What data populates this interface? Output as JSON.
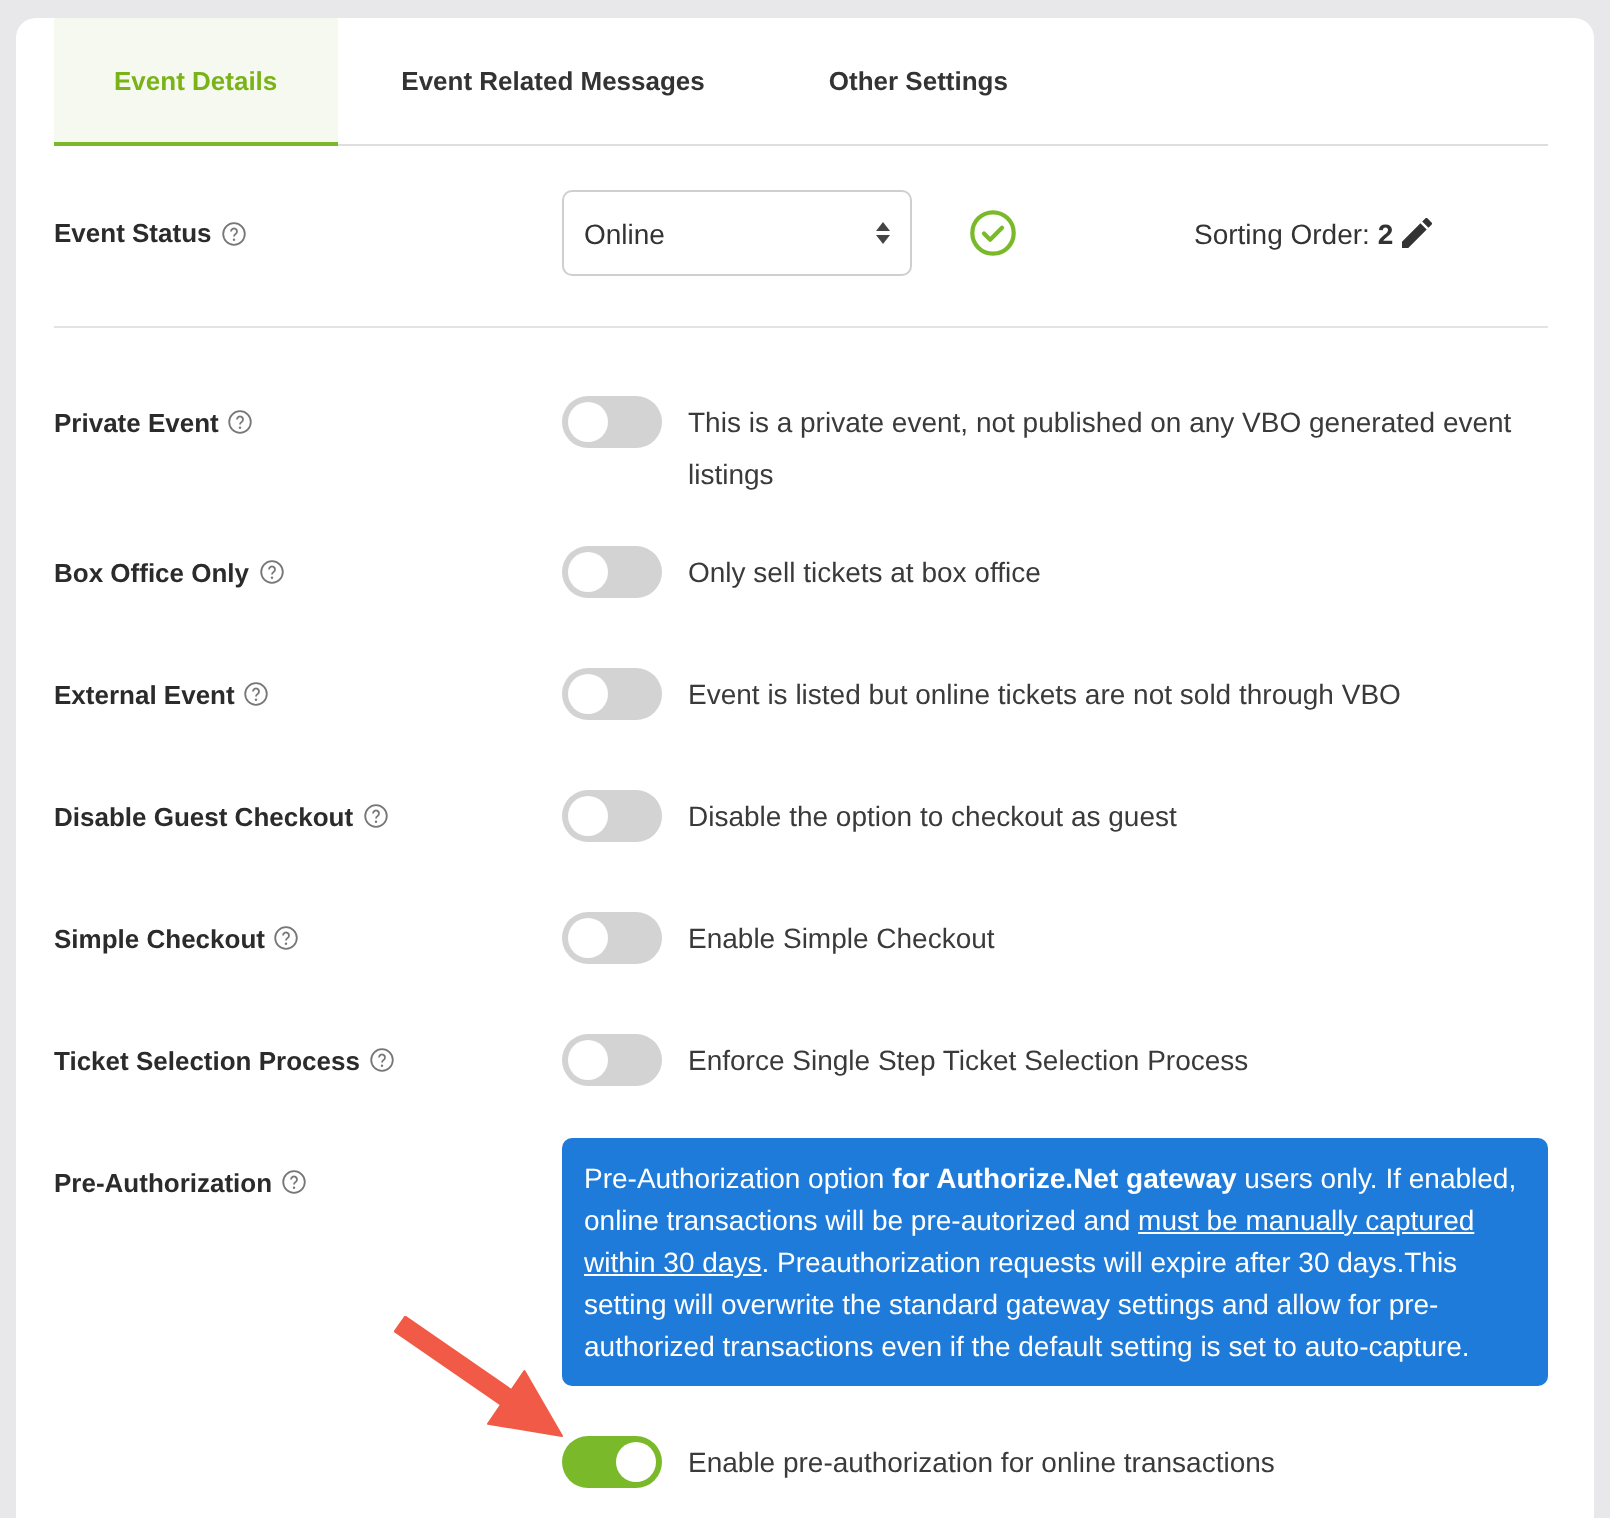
{
  "tabs": [
    {
      "label": "Event Details",
      "selected": true
    },
    {
      "label": "Event Related Messages",
      "selected": false
    },
    {
      "label": "Other Settings",
      "selected": false
    }
  ],
  "event_status": {
    "label": "Event Status",
    "value": "Online",
    "sorting_order": "Sorting Order: **2**"
  },
  "settings": [
    {
      "kind": "toggle",
      "label": "Private Event",
      "on": false,
      "description": "This is a private event, not published on any VBO generated event listings"
    },
    {
      "kind": "toggle",
      "label": "Box Office Only",
      "on": false,
      "description": "Only sell tickets at box office"
    },
    {
      "kind": "toggle",
      "label": "External Event",
      "on": false,
      "description": "Event is listed but online tickets are not sold through VBO"
    },
    {
      "kind": "toggle",
      "label": "Disable Guest Checkout",
      "on": false,
      "description": "Disable the option to checkout as guest"
    },
    {
      "kind": "toggle",
      "label": "Simple Checkout",
      "on": false,
      "description": "Enable Simple Checkout"
    },
    {
      "kind": "toggle",
      "label": "Ticket Selection Process",
      "on": false,
      "description": "Enforce Single Step Ticket Selection Process"
    },
    {
      "kind": "toggle_with_notice",
      "label": "Pre-Authorization",
      "notice": [
        {
          "kind": "text",
          "text": "Pre-Authorization option "
        },
        {
          "kind": "bold",
          "text": "for Authorize.Net gateway"
        },
        {
          "kind": "text",
          "text": " users only. If enabled, online transactions will be pre-autorized and "
        },
        {
          "kind": "underline",
          "text": "must be manually captured within 30 days"
        },
        {
          "kind": "text",
          "text": ". Preauthorization requests will expire after 30 days.This setting will overwrite the standard gateway settings and allow for pre-authorized transactions even if the default setting is set to auto-capture."
        }
      ],
      "on": true,
      "description": "Enable pre-authorization for online transactions"
    }
  ]
}
